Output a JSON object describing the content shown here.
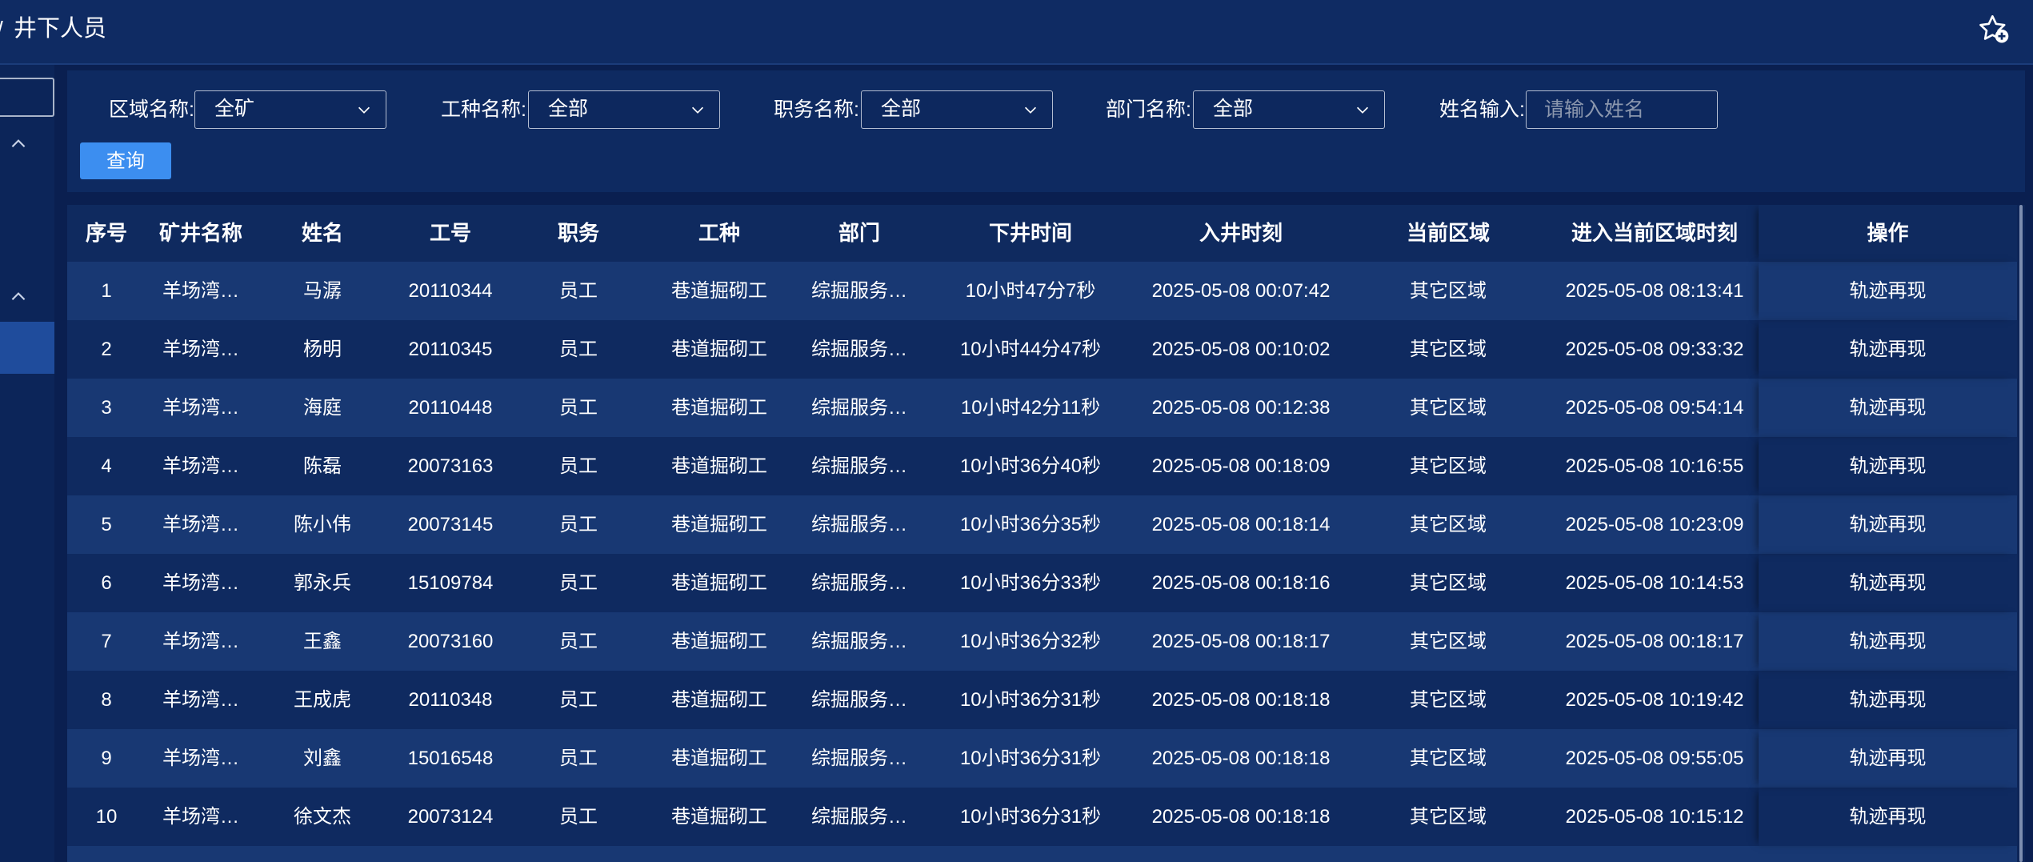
{
  "header": {
    "separator": "/",
    "title": "井下人员",
    "favorite_icon": "star-plus-icon"
  },
  "filters": {
    "area": {
      "label": "区域名称:",
      "value": "全矿"
    },
    "job_type": {
      "label": "工种名称:",
      "value": "全部"
    },
    "position": {
      "label": "职务名称:",
      "value": "全部"
    },
    "department": {
      "label": "部门名称:",
      "value": "全部"
    },
    "name": {
      "label": "姓名输入:",
      "placeholder": "请输入姓名"
    },
    "query_label": "查询"
  },
  "table": {
    "columns": [
      "序号",
      "矿井名称",
      "姓名",
      "工号",
      "职务",
      "工种",
      "部门",
      "下井时间",
      "入井时刻",
      "当前区域",
      "进入当前区域时刻",
      "操作"
    ],
    "rows": [
      [
        "1",
        "羊场湾…",
        "马潺",
        "20110344",
        "员工",
        "巷道掘砌工",
        "综掘服务…",
        "10小时47分7秒",
        "2025-05-08 00:07:42",
        "其它区域",
        "2025-05-08 08:13:41",
        "轨迹再现"
      ],
      [
        "2",
        "羊场湾…",
        "杨明",
        "20110345",
        "员工",
        "巷道掘砌工",
        "综掘服务…",
        "10小时44分47秒",
        "2025-05-08 00:10:02",
        "其它区域",
        "2025-05-08 09:33:32",
        "轨迹再现"
      ],
      [
        "3",
        "羊场湾…",
        "海庭",
        "20110448",
        "员工",
        "巷道掘砌工",
        "综掘服务…",
        "10小时42分11秒",
        "2025-05-08 00:12:38",
        "其它区域",
        "2025-05-08 09:54:14",
        "轨迹再现"
      ],
      [
        "4",
        "羊场湾…",
        "陈磊",
        "20073163",
        "员工",
        "巷道掘砌工",
        "综掘服务…",
        "10小时36分40秒",
        "2025-05-08 00:18:09",
        "其它区域",
        "2025-05-08 10:16:55",
        "轨迹再现"
      ],
      [
        "5",
        "羊场湾…",
        "陈小伟",
        "20073145",
        "员工",
        "巷道掘砌工",
        "综掘服务…",
        "10小时36分35秒",
        "2025-05-08 00:18:14",
        "其它区域",
        "2025-05-08 10:23:09",
        "轨迹再现"
      ],
      [
        "6",
        "羊场湾…",
        "郭永兵",
        "15109784",
        "员工",
        "巷道掘砌工",
        "综掘服务…",
        "10小时36分33秒",
        "2025-05-08 00:18:16",
        "其它区域",
        "2025-05-08 10:14:53",
        "轨迹再现"
      ],
      [
        "7",
        "羊场湾…",
        "王鑫",
        "20073160",
        "员工",
        "巷道掘砌工",
        "综掘服务…",
        "10小时36分32秒",
        "2025-05-08 00:18:17",
        "其它区域",
        "2025-05-08 00:18:17",
        "轨迹再现"
      ],
      [
        "8",
        "羊场湾…",
        "王成虎",
        "20110348",
        "员工",
        "巷道掘砌工",
        "综掘服务…",
        "10小时36分31秒",
        "2025-05-08 00:18:18",
        "其它区域",
        "2025-05-08 10:19:42",
        "轨迹再现"
      ],
      [
        "9",
        "羊场湾…",
        "刘鑫",
        "15016548",
        "员工",
        "巷道掘砌工",
        "综掘服务…",
        "10小时36分31秒",
        "2025-05-08 00:18:18",
        "其它区域",
        "2025-05-08 09:55:05",
        "轨迹再现"
      ],
      [
        "10",
        "羊场湾…",
        "徐文杰",
        "20073124",
        "员工",
        "巷道掘砌工",
        "综掘服务…",
        "10小时36分31秒",
        "2025-05-08 00:18:18",
        "其它区域",
        "2025-05-08 10:15:12",
        "轨迹再现"
      ]
    ]
  },
  "colors": {
    "background": "#0a1f50",
    "header": "#0f2b63",
    "accent": "#3c8ef0",
    "row_light": "#183873",
    "row_dark": "#0f2a60",
    "sidebar_active": "#1f4c9c"
  }
}
